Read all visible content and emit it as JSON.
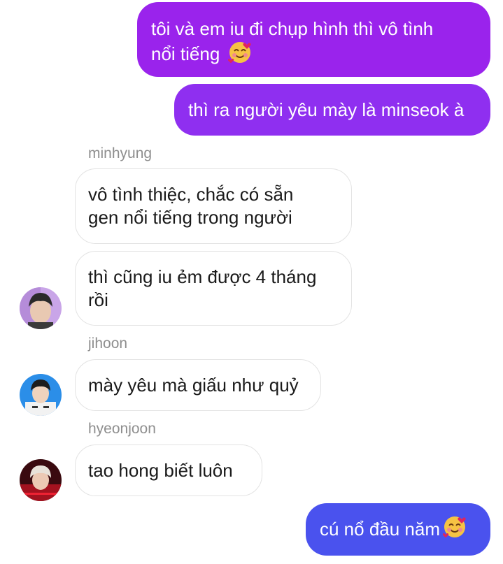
{
  "messages": {
    "m1": {
      "line1": "tôi và em iu đi chụp hình thì vô tình",
      "line2": "nổi tiếng"
    },
    "m2": {
      "text": "thì ra người yêu mày là minseok à"
    },
    "minhyung": {
      "name": "minhyung",
      "b1_line1": "vô tình thiệc, chắc có sẵn",
      "b1_line2": "gen nổi tiếng trong người",
      "b2_line1": "thì cũng iu ẻm được 4 tháng",
      "b2_line2": "rồi"
    },
    "jihoon": {
      "name": "jihoon",
      "text": "mày yêu mà giấu như quỷ"
    },
    "hyeonjoon": {
      "name": "hyeonjoon",
      "text": "tao hong biết luôn"
    },
    "m_last": {
      "text": "cú nổ đầu năm"
    }
  },
  "colors": {
    "bubble_purple": "#9a23ec",
    "bubble_purple2": "#8f2ff0",
    "bubble_blue": "#4a52ee",
    "sender_gray": "#8e8e8e"
  },
  "icons": {
    "emoji": "smiling-face-with-hearts-icon"
  }
}
